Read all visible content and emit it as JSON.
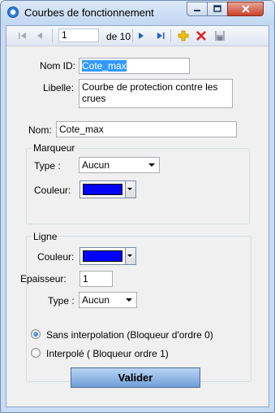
{
  "window": {
    "title": "Courbes de fonctionnement"
  },
  "toolbar": {
    "current_record": "1",
    "of_label": "de 10"
  },
  "form": {
    "nom_id_label": "Nom ID:",
    "nom_id_value": "Cote_max",
    "libelle_label": "Libelle:",
    "libelle_value": "Courbe de protection contre les crues",
    "nom_label": "Nom:",
    "nom_value": "Cote_max"
  },
  "marqueur": {
    "title": "Marqueur",
    "type_label": "Type :",
    "type_value": "Aucun",
    "couleur_label": "Couleur:",
    "couleur_color": "#0000ff"
  },
  "ligne": {
    "title": "Ligne",
    "couleur_label": "Couleur:",
    "couleur_color": "#0000ff",
    "epaisseur_label": "Epaisseur:",
    "epaisseur_value": "1",
    "type_label": "Type :",
    "type_value": "Aucun",
    "radio_sans": "Sans interpolation (Bloqueur d'ordre 0)",
    "radio_interpole": "Interpolé ( Bloqueur ordre 1)",
    "selected": "sans"
  },
  "actions": {
    "valider_label": "Valider"
  }
}
